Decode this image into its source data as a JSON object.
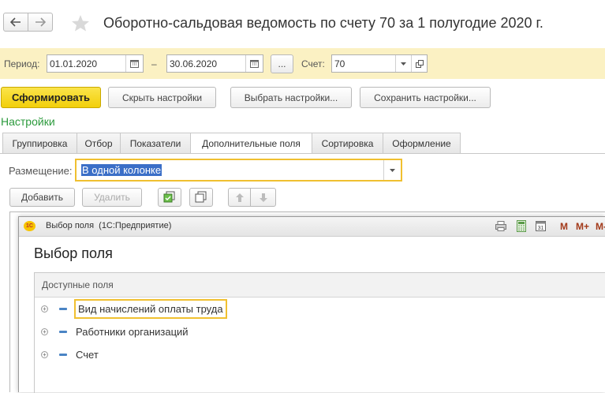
{
  "header": {
    "back_icon": "arrow-left-icon",
    "forward_icon": "arrow-right-icon",
    "favorite_icon": "star-icon",
    "title": "Оборотно-сальдовая ведомость по счету 70 за 1 полугодие 2020 г."
  },
  "period_bar": {
    "period_label": "Период:",
    "date_from": "01.01.2020",
    "dash": "–",
    "date_to": "30.06.2020",
    "ellipsis_label": "...",
    "account_label": "Счет:",
    "account_value": "70"
  },
  "toolbar": {
    "generate_label": "Сформировать",
    "hide_settings_label": "Скрыть настройки",
    "select_settings_label": "Выбрать настройки...",
    "save_settings_label": "Сохранить настройки..."
  },
  "settings": {
    "heading": "Настройки",
    "tabs": [
      {
        "label": "Группировка"
      },
      {
        "label": "Отбор"
      },
      {
        "label": "Показатели"
      },
      {
        "label": "Дополнительные поля"
      },
      {
        "label": "Сортировка"
      },
      {
        "label": "Оформление"
      }
    ],
    "active_tab": "Дополнительные поля",
    "placement_label": "Размещение:",
    "placement_value": "В одной колонке",
    "add_label": "Добавить",
    "delete_label": "Удалить"
  },
  "dialog": {
    "window_title": "Выбор поля  (1С:Предприятие)",
    "logo_text": "1С",
    "title_icons": [
      "print-icon",
      "calculator-icon",
      "calendar-icon"
    ],
    "memory_buttons": [
      "M",
      "M+",
      "M-"
    ],
    "heading": "Выбор поля",
    "column_header": "Доступные поля",
    "fields": [
      {
        "label": "Вид начислений оплаты труда",
        "selected": true
      },
      {
        "label": "Работники организаций",
        "selected": false
      },
      {
        "label": "Счет",
        "selected": false
      }
    ]
  },
  "colors": {
    "accent_yellow": "#f5d80f",
    "period_bar_bg": "#fbf1c3",
    "settings_green": "#2b9a3c",
    "selection_blue": "#3b6fc7",
    "focus_border": "#f0c030"
  }
}
